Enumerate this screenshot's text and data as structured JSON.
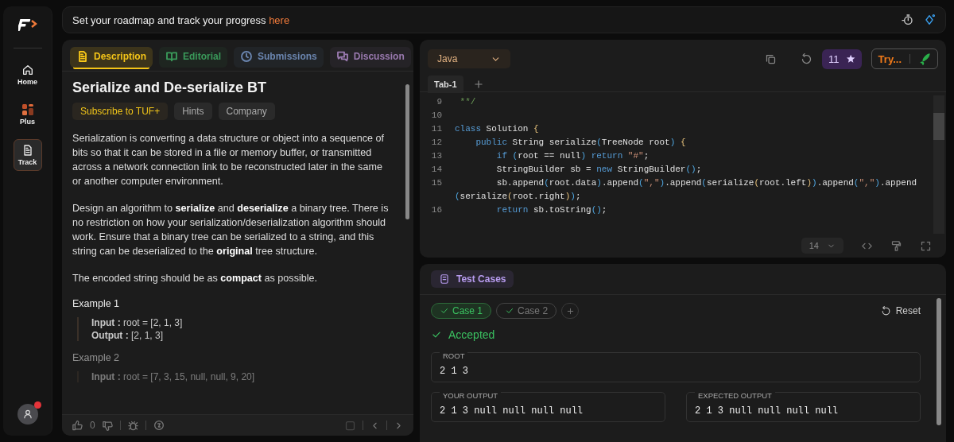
{
  "sidebar": {
    "items": [
      {
        "label": "Home",
        "selected": false
      },
      {
        "label": "Plus",
        "selected": false
      },
      {
        "label": "Track",
        "selected": true
      }
    ],
    "notification": true
  },
  "banner": {
    "text": "Set your roadmap and track your progress",
    "link": "here"
  },
  "problem": {
    "tabs": [
      {
        "label": "Description",
        "color": "#f5c518",
        "selected": true
      },
      {
        "label": "Editorial",
        "color": "#3a9a5a",
        "selected": false
      },
      {
        "label": "Submissions",
        "color": "#6b86b0",
        "selected": false
      },
      {
        "label": "Discussion",
        "color": "#9a7ab0",
        "selected": false
      }
    ],
    "title": "Serialize and De-serialize BT",
    "tags": [
      {
        "label": "Subscribe to TUF+",
        "kind": "premium"
      },
      {
        "label": "Hints",
        "kind": "plain"
      },
      {
        "label": "Company",
        "kind": "plain"
      }
    ],
    "paragraphs": [
      "Serialization is converting a data structure or object into a sequence of bits so that it can be stored in a file or memory buffer, or transmitted across a network connection link to be reconstructed later in the same or another computer environment.",
      "Design an algorithm to **serialize** and **deserialize** a binary tree. There is no restriction on how your serialization/deserialization algorithm should work. Ensure that a binary tree can be serialized to a string, and this string can be deserialized to the **original** tree structure.",
      "The encoded string should be as **compact** as possible."
    ],
    "examples": [
      {
        "title": "Example 1",
        "lines": [
          "**Input :** root = [2, 1, 3]",
          "**Output :** [2, 1, 3]"
        ]
      },
      {
        "title": "Example 2",
        "lines": [
          "**Input :** root = [7, 3, 15, null, null, 9, 20]"
        ]
      }
    ],
    "likes": "0"
  },
  "editor": {
    "language": "Java",
    "stars": "11",
    "try_label": "Try...",
    "tabs": [
      {
        "label": "Tab-1",
        "selected": true
      }
    ],
    "lines": [
      {
        "number": "9",
        "segments": [
          {
            "kind": "comment",
            "text": " **/"
          }
        ]
      },
      {
        "number": "10"
      },
      {
        "number": "11",
        "segments": [
          {
            "kind": "keyword",
            "text": "class"
          },
          {
            "kind": "plain",
            "text": " Solution "
          },
          {
            "kind": "brace",
            "text": "{"
          }
        ]
      },
      {
        "number": "12",
        "segments": [
          {
            "kind": "keyword",
            "text": "    public"
          },
          {
            "kind": "plain",
            "text": " String serialize"
          },
          {
            "kind": "bracket",
            "text": "("
          },
          {
            "kind": "plain",
            "text": "TreeNode root"
          },
          {
            "kind": "bracket",
            "text": ")"
          },
          {
            "kind": "brace",
            "text": " {"
          }
        ]
      },
      {
        "number": "13",
        "segments": [
          {
            "kind": "keyword",
            "text": "        if"
          },
          {
            "kind": "bracket",
            "text": " ("
          },
          {
            "kind": "plain",
            "text": "root == null"
          },
          {
            "kind": "bracket",
            "text": ")"
          },
          {
            "kind": "keyword",
            "text": " return"
          },
          {
            "kind": "string",
            "text": " \"#\""
          },
          {
            "kind": "plain",
            "text": ";"
          }
        ]
      },
      {
        "number": "14",
        "segments": [
          {
            "kind": "plain",
            "text": "        StringBuilder sb = "
          },
          {
            "kind": "keyword",
            "text": "new"
          },
          {
            "kind": "plain",
            "text": " StringBuilder"
          },
          {
            "kind": "bracket",
            "text": "()"
          },
          {
            "kind": "plain",
            "text": ";"
          }
        ]
      },
      {
        "number": "15",
        "segments": [
          {
            "kind": "plain",
            "text": "        sb.append"
          },
          {
            "kind": "bracket",
            "text": "("
          },
          {
            "kind": "plain",
            "text": "root.data"
          },
          {
            "kind": "bracket",
            "text": ")"
          },
          {
            "kind": "plain",
            "text": ".append"
          },
          {
            "kind": "bracket",
            "text": "("
          },
          {
            "kind": "string",
            "text": "\",\""
          },
          {
            "kind": "bracket",
            "text": ")"
          },
          {
            "kind": "plain",
            "text": ".append"
          },
          {
            "kind": "bracket",
            "text": "("
          },
          {
            "kind": "plain",
            "text": "serialize"
          },
          {
            "kind": "brace",
            "text": "("
          },
          {
            "kind": "plain",
            "text": "root.left"
          },
          {
            "kind": "brace",
            "text": ")"
          },
          {
            "kind": "bracket",
            "text": ")"
          },
          {
            "kind": "plain",
            "text": ".append"
          },
          {
            "kind": "bracket",
            "text": "("
          },
          {
            "kind": "string",
            "text": "\",\""
          },
          {
            "kind": "bracket",
            "text": ")"
          },
          {
            "kind": "plain",
            "text": ".append"
          },
          {
            "kind": "bracket",
            "text": " ("
          },
          {
            "kind": "plain",
            "text": "serialize"
          },
          {
            "kind": "brace",
            "text": "("
          },
          {
            "kind": "plain",
            "text": "root.right"
          },
          {
            "kind": "brace",
            "text": ")"
          },
          {
            "kind": "bracket",
            "text": ")"
          },
          {
            "kind": "plain",
            "text": ";"
          }
        ]
      },
      {
        "number": "16",
        "segments": [
          {
            "kind": "keyword",
            "text": "        return"
          },
          {
            "kind": "plain",
            "text": " sb.toString"
          },
          {
            "kind": "bracket",
            "text": "()"
          },
          {
            "kind": "plain",
            "text": ";"
          }
        ]
      }
    ],
    "font_size": "14"
  },
  "tests": {
    "tab": "Test Cases",
    "cases": [
      {
        "label": "Case 1",
        "passed": true,
        "selected": true
      },
      {
        "label": "Case 2",
        "passed": true,
        "selected": false
      }
    ],
    "reset": "Reset",
    "status": "Accepted",
    "fields": [
      {
        "label": "ROOT",
        "value": "2 1 3",
        "kind": "wide"
      },
      {
        "label": "YOUR OUTPUT",
        "value": "2 1 3 null null null null",
        "kind": "half"
      },
      {
        "label": "EXPECTED OUTPUT",
        "value": "2 1 3 null null null null",
        "kind": "half"
      }
    ]
  }
}
